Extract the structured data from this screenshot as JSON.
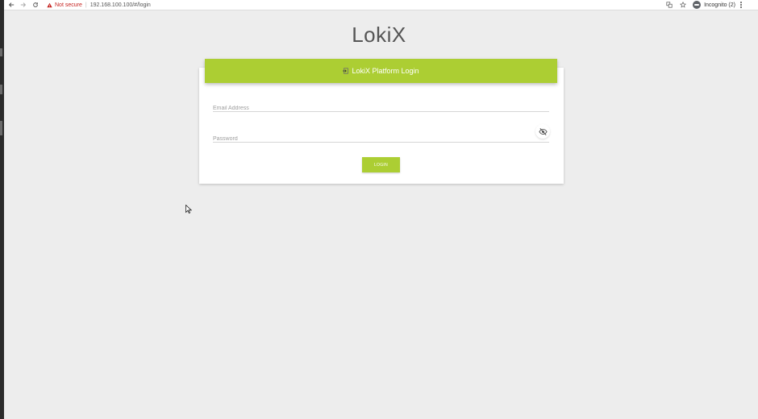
{
  "browser": {
    "security_label": "Not secure",
    "separator": "|",
    "url": "192.168.100.100/#/login",
    "profile_label": "Incognito (2)"
  },
  "app": {
    "title": "LokiX"
  },
  "login_card": {
    "header_label": "LokiX Platform Login",
    "email_placeholder": "Email Address",
    "password_placeholder": "Password",
    "login_button_label": "LOGIN"
  },
  "colors": {
    "accent": "#acce33",
    "background": "#ededed",
    "warning": "#c5221f"
  },
  "icons": {
    "back": "arrow-left-icon",
    "forward": "arrow-right-icon",
    "reload": "reload-icon",
    "warning": "warning-triangle-icon",
    "translate": "translate-icon",
    "bookmark": "star-icon",
    "incognito": "incognito-icon",
    "menu": "more-vert-icon",
    "login": "login-icon",
    "visibility": "visibility-off-icon",
    "cursor": "mouse-pointer-icon"
  }
}
